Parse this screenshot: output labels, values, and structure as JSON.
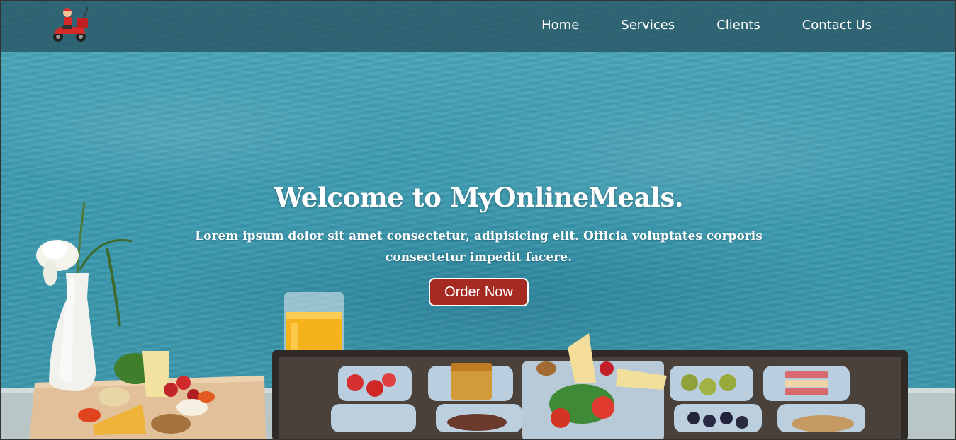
{
  "nav": {
    "logo_icon": "delivery-scooter-logo",
    "links": [
      {
        "label": "Home"
      },
      {
        "label": "Services"
      },
      {
        "label": "Clients"
      },
      {
        "label": "Contact Us"
      }
    ]
  },
  "hero": {
    "title": "Welcome to MyOnlineMeals.",
    "subtitle": "Lorem ipsum dolor sit amet consectetur, adipisicing elit. Officia voluptates corporis consectetur impedit facere.",
    "cta_label": "Order Now"
  },
  "colors": {
    "navbar_bg": "#265260",
    "cta_bg": "#a52a22",
    "water": "#3f9db2"
  }
}
